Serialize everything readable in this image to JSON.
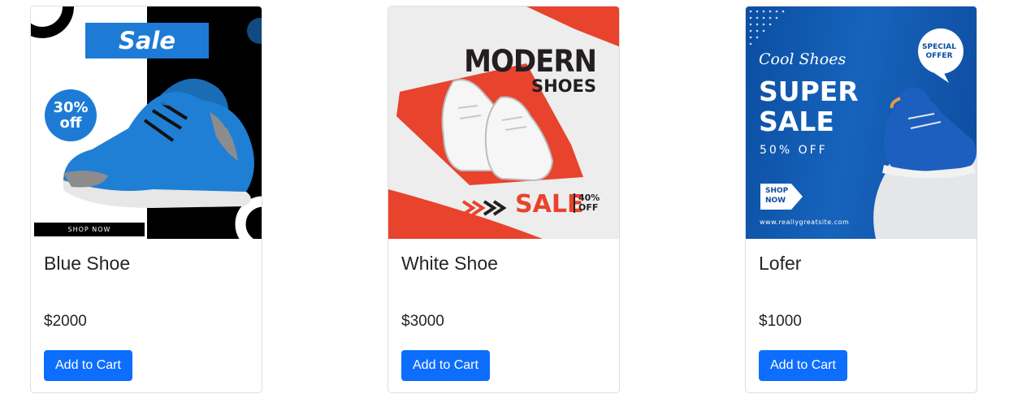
{
  "products": [
    {
      "title": "Blue Shoe",
      "price": "$2000",
      "button_label": "Add to Cart",
      "banner": {
        "headline": "Sale",
        "badge": "30% off",
        "cta": "SHOP NOW"
      }
    },
    {
      "title": "White Shoe",
      "price": "$3000",
      "button_label": "Add to Cart",
      "banner": {
        "headline_1": "MODERN",
        "headline_2": "SHOES",
        "sale": "SALE",
        "discount": "40% OFF"
      }
    },
    {
      "title": "Lofer",
      "price": "$1000",
      "button_label": "Add to Cart",
      "banner": {
        "script": "Cool Shoes",
        "headline": "SUPER SALE",
        "discount": "50% OFF",
        "cta": "SHOP NOW",
        "site": "www.reallygreatsite.com",
        "offer": "SPECIAL OFFER"
      }
    }
  ],
  "colors": {
    "button": "#0d6efd",
    "sale_blue": "#1d7bd6",
    "sale_red": "#e8432d",
    "banner_navy": "#0b4ea2"
  }
}
